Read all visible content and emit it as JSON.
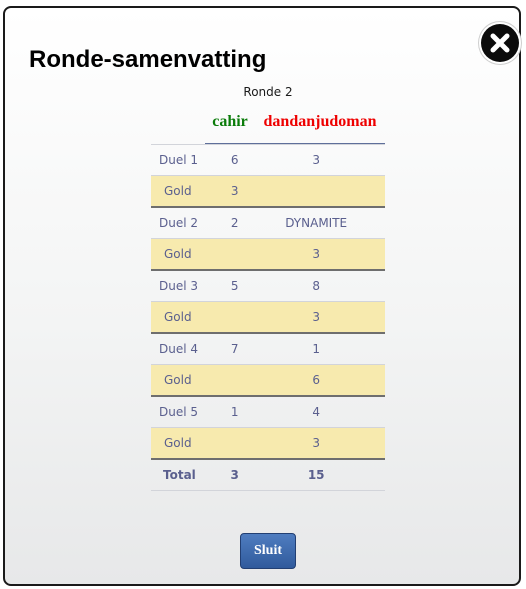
{
  "dialog": {
    "title": "Ronde-samenvatting",
    "round_label": "Ronde 2",
    "close_icon": "close-circle-icon",
    "button_label": "Sluit"
  },
  "players": {
    "p1": {
      "name": "cahir",
      "color": "#0a7c0a"
    },
    "p2": {
      "name": "dandanjudoman",
      "color": "#ee0000"
    }
  },
  "rows": [
    {
      "type": "duel",
      "label": "Duel 1",
      "p1": "6",
      "p2": "3"
    },
    {
      "type": "gold",
      "label": "Gold",
      "p1": "3",
      "p2": ""
    },
    {
      "type": "duel",
      "label": "Duel 2",
      "p1": "2",
      "p2": "DYNAMITE"
    },
    {
      "type": "gold",
      "label": "Gold",
      "p1": "",
      "p2": "3"
    },
    {
      "type": "duel",
      "label": "Duel 3",
      "p1": "5",
      "p2": "8"
    },
    {
      "type": "gold",
      "label": "Gold",
      "p1": "",
      "p2": "3"
    },
    {
      "type": "duel",
      "label": "Duel 4",
      "p1": "7",
      "p2": "1"
    },
    {
      "type": "gold",
      "label": "Gold",
      "p1": "",
      "p2": "6"
    },
    {
      "type": "duel",
      "label": "Duel 5",
      "p1": "1",
      "p2": "4"
    },
    {
      "type": "gold",
      "label": "Gold",
      "p1": "",
      "p2": "3"
    }
  ],
  "total": {
    "label": "Total",
    "p1": "3",
    "p2": "15"
  },
  "colors": {
    "gold_row": "#f7eaae",
    "button": "#3f6aae",
    "header_line": "#5f6f9a"
  }
}
